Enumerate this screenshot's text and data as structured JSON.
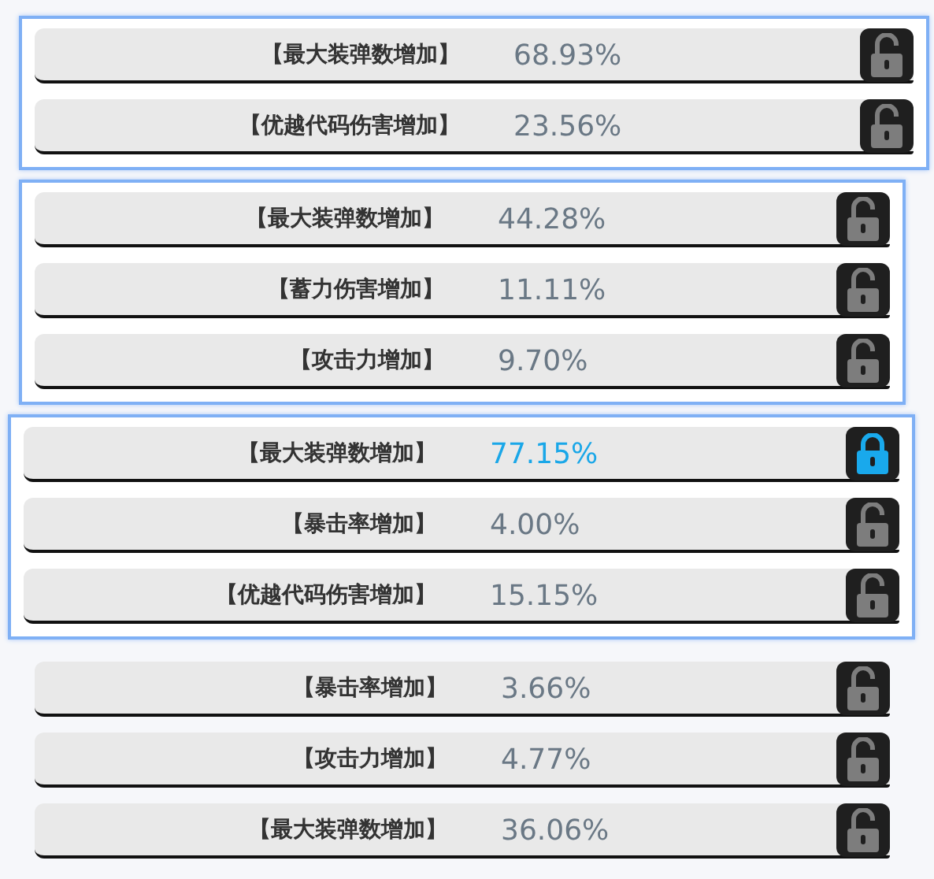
{
  "groups": [
    {
      "framed": true,
      "rows": [
        {
          "label": "【最大装弹数增加】",
          "value": "68.93%",
          "locked": false
        },
        {
          "label": "【优越代码伤害增加】",
          "value": "23.56%",
          "locked": false
        }
      ]
    },
    {
      "framed": true,
      "rows": [
        {
          "label": "【最大装弹数增加】",
          "value": "44.28%",
          "locked": false
        },
        {
          "label": "【蓄力伤害增加】",
          "value": "11.11%",
          "locked": false
        },
        {
          "label": "【攻击力增加】",
          "value": "9.70%",
          "locked": false
        }
      ]
    },
    {
      "framed": true,
      "rows": [
        {
          "label": "【最大装弹数增加】",
          "value": "77.15%",
          "locked": true
        },
        {
          "label": "【暴击率增加】",
          "value": "4.00%",
          "locked": false
        },
        {
          "label": "【优越代码伤害增加】",
          "value": "15.15%",
          "locked": false
        }
      ]
    },
    {
      "framed": false,
      "rows": [
        {
          "label": "【暴击率增加】",
          "value": "3.66%",
          "locked": false
        },
        {
          "label": "【攻击力增加】",
          "value": "4.77%",
          "locked": false
        },
        {
          "label": "【最大装弹数增加】",
          "value": "36.06%",
          "locked": false
        }
      ]
    }
  ]
}
